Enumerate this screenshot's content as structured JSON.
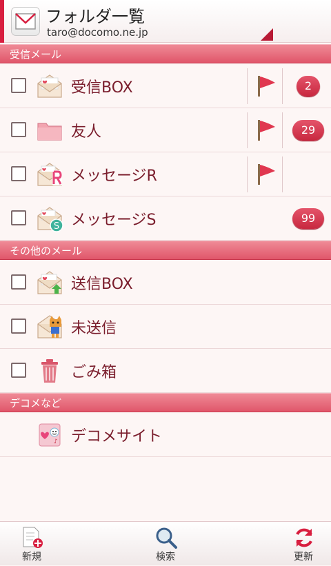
{
  "header": {
    "title": "フォルダ一覧",
    "account": "taro@docomo.ne.jp"
  },
  "sections": {
    "inbox": "受信メール",
    "other": "その他のメール",
    "deco": "デコメなど"
  },
  "rows": {
    "inbox_box": {
      "label": "受信BOX",
      "count": "2"
    },
    "friends": {
      "label": "友人",
      "count": "29"
    },
    "message_r": {
      "label": "メッセージR"
    },
    "message_s": {
      "label": "メッセージS",
      "count": "99"
    },
    "outbox": {
      "label": "送信BOX"
    },
    "unsent": {
      "label": "未送信"
    },
    "trash": {
      "label": "ごみ箱"
    },
    "deco_site": {
      "label": "デコメサイト"
    }
  },
  "bottom_bar": {
    "new": "新規",
    "search": "検索",
    "refresh": "更新"
  },
  "colors": {
    "accent": "#d81e3f",
    "text": "#7a1d2c",
    "badge": "#c8283f"
  }
}
